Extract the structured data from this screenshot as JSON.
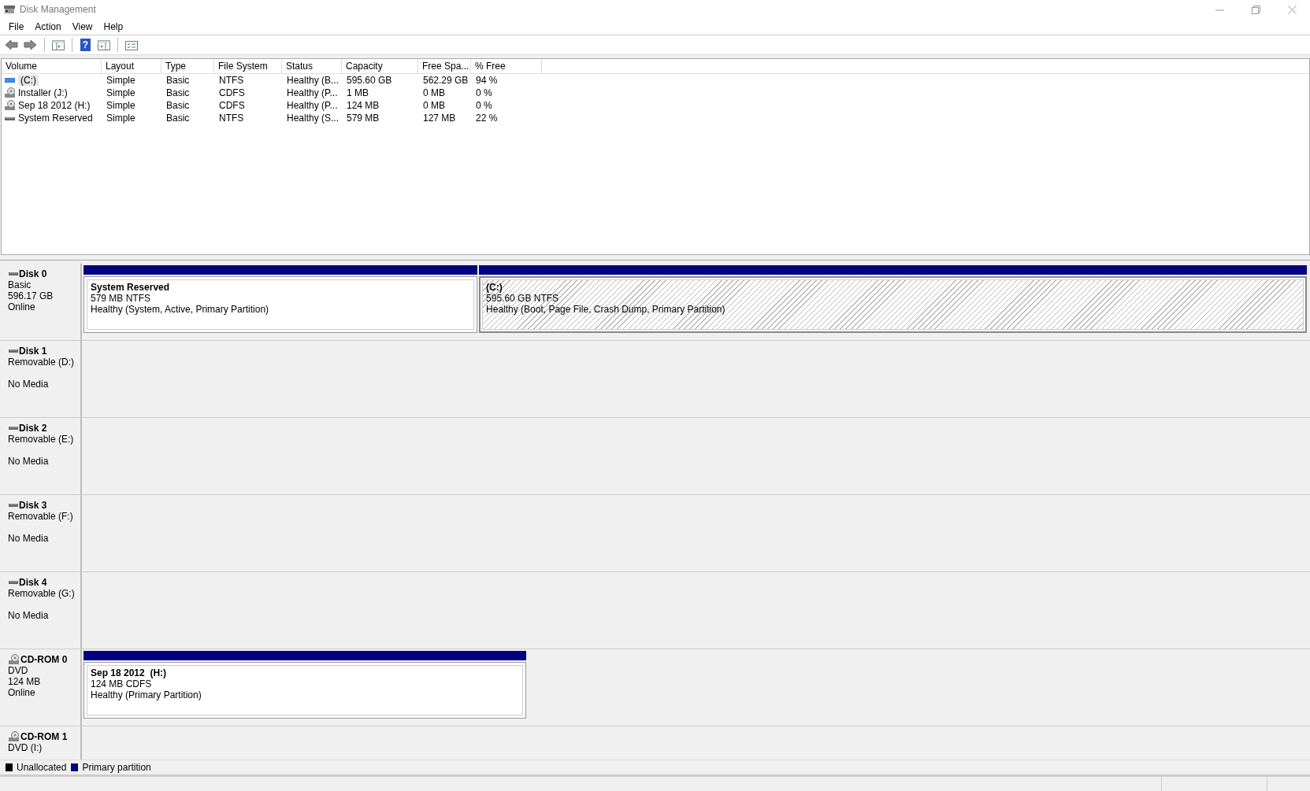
{
  "window": {
    "title": "Disk Management"
  },
  "menu": [
    {
      "label": "File"
    },
    {
      "label": "Action"
    },
    {
      "label": "View"
    },
    {
      "label": "Help"
    }
  ],
  "toolbar": [
    {
      "kind": "back"
    },
    {
      "kind": "forward"
    },
    {
      "kind": "separator"
    },
    {
      "kind": "tree"
    },
    {
      "kind": "separator"
    },
    {
      "kind": "help",
      "glyph": "?"
    },
    {
      "kind": "pane"
    },
    {
      "kind": "separator"
    },
    {
      "kind": "properties"
    }
  ],
  "volume_table": {
    "columns": [
      "Volume",
      "Layout",
      "Type",
      "File System",
      "Status",
      "Capacity",
      "Free Spa...",
      "% Free"
    ],
    "rows": [
      {
        "kind": "system-drive",
        "selected": true,
        "cells": [
          "(C:)",
          "Simple",
          "Basic",
          "NTFS",
          "Healthy (B...",
          "595.60 GB",
          "562.29 GB",
          "94 %"
        ]
      },
      {
        "kind": "disc",
        "selected": false,
        "cells": [
          "Installer (J:)",
          "Simple",
          "Basic",
          "CDFS",
          "Healthy (P...",
          "1 MB",
          "0 MB",
          "0 %"
        ]
      },
      {
        "kind": "disc",
        "selected": false,
        "cells": [
          "Sep 18 2012 (H:)",
          "Simple",
          "Basic",
          "CDFS",
          "Healthy (P...",
          "124 MB",
          "0 MB",
          "0 %"
        ]
      },
      {
        "kind": "drive",
        "selected": false,
        "cells": [
          "System Reserved",
          "Simple",
          "Basic",
          "NTFS",
          "Healthy (S...",
          "579 MB",
          "127 MB",
          "22 %"
        ]
      }
    ]
  },
  "disks": [
    {
      "kind": "disk",
      "name": "Disk 0",
      "type": "Basic",
      "capacity": "596.17 GB",
      "status": "Online",
      "partitions": [
        {
          "title": "System Reserved",
          "size": "579 MB NTFS",
          "health": "Healthy (System, Active, Primary Partition)",
          "selected": false
        },
        {
          "title": "(C:)",
          "size": "595.60 GB NTFS",
          "health": "Healthy (Boot, Page File, Crash Dump, Primary Partition)",
          "selected": true
        }
      ]
    },
    {
      "kind": "disk",
      "name": "Disk 1",
      "type": "Removable (D:)",
      "status": "No Media"
    },
    {
      "kind": "disk",
      "name": "Disk 2",
      "type": "Removable (E:)",
      "status": "No Media"
    },
    {
      "kind": "disk",
      "name": "Disk 3",
      "type": "Removable (F:)",
      "status": "No Media"
    },
    {
      "kind": "disk",
      "name": "Disk 4",
      "type": "Removable (G:)",
      "status": "No Media"
    },
    {
      "kind": "cdrom",
      "name": "CD-ROM 0",
      "type": "DVD",
      "capacity": "124 MB",
      "status": "Online",
      "partitions": [
        {
          "title": "Sep 18 2012  (H:)",
          "size": "124 MB CDFS",
          "health": "Healthy (Primary Partition)",
          "selected": false
        }
      ]
    },
    {
      "kind": "cdrom",
      "name": "CD-ROM 1",
      "type": "DVD (I:)"
    }
  ],
  "legend": [
    {
      "label": "Unallocated",
      "color": "#000000"
    },
    {
      "label": "Primary partition",
      "color": "#000080"
    }
  ]
}
